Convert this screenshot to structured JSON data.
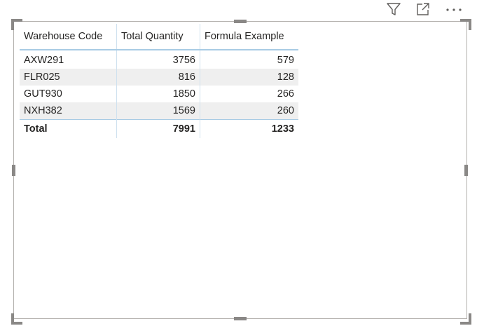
{
  "header_icons": {
    "filter": "filter-icon",
    "focus": "focus-mode-icon",
    "more": "more-options-icon"
  },
  "table": {
    "columns": [
      "Warehouse Code",
      "Total Quantity",
      "Formula Example"
    ],
    "rows": [
      {
        "code": "AXW291",
        "qty": "3756",
        "formula": "579"
      },
      {
        "code": "FLR025",
        "qty": "816",
        "formula": "128"
      },
      {
        "code": "GUT930",
        "qty": "1850",
        "formula": "266"
      },
      {
        "code": "NXH382",
        "qty": "1569",
        "formula": "260"
      }
    ],
    "total": {
      "label": "Total",
      "qty": "7991",
      "formula": "1233"
    }
  },
  "colors": {
    "border": "#b3b0ad",
    "handle": "#8a8886",
    "header_underline": "#a8cbe4",
    "alt_row": "#efefef"
  }
}
